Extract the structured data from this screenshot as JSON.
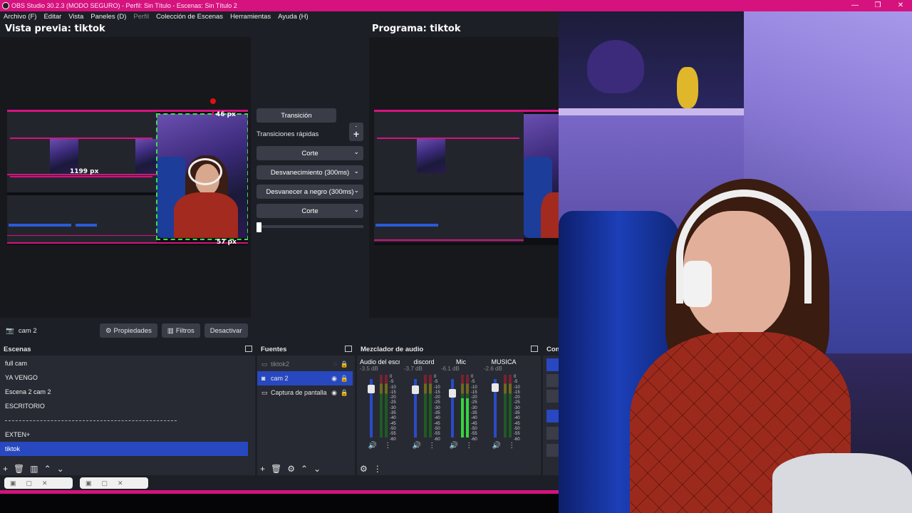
{
  "window": {
    "title": "OBS Studio 30.2.3 (MODO SEGURO) - Perfil: Sin Título - Escenas: Sin Título 2",
    "minimize": "—",
    "restore": "❐",
    "close": "✕"
  },
  "menu": {
    "file": "Archivo (F)",
    "edit": "Editar",
    "view": "Vista",
    "docks": "Paneles (D)",
    "profile": "Perfil",
    "scene_collection": "Colección de Escenas",
    "tools": "Herramientas",
    "help": "Ayuda (H)"
  },
  "preview": {
    "title": "Vista previa: tiktok",
    "label_top": "46 px",
    "label_left": "1199 px",
    "label_bottom": "57 px"
  },
  "program": {
    "title": "Programa: tiktok"
  },
  "transitions": {
    "transition_button": "Transición",
    "quick_label": "Transiciones rápidas",
    "items": [
      "Corte",
      "Desvanecimiento (300ms)",
      "Desvanecer a negro (300ms)",
      "Corte"
    ],
    "slider_value": 0
  },
  "context_bar": {
    "source_name": "cam 2",
    "properties": "Propiedades",
    "filters": "Filtros",
    "deactivate": "Desactivar"
  },
  "scenes": {
    "title": "Escenas",
    "items": [
      "full cam",
      "YA VENGO",
      "Escena 2 cam 2",
      "ESCRITORIO",
      "",
      "EXTEN+",
      "tiktok"
    ],
    "selected": "tiktok"
  },
  "sources": {
    "title": "Fuentes",
    "items": [
      {
        "name": "tiktok2",
        "icon": "scene-icon",
        "visible": false
      },
      {
        "name": "cam 2",
        "icon": "camera-icon",
        "visible": true
      },
      {
        "name": "Captura de pantalla",
        "icon": "monitor-icon",
        "visible": true
      }
    ],
    "selected": "cam 2"
  },
  "mixer": {
    "title": "Mezclador de audio",
    "channels": [
      {
        "name": "Audio del escrito",
        "db": "-3.5 dB",
        "level": 0.0,
        "fader": 0.88
      },
      {
        "name": "discord",
        "db": "-3.7 dB",
        "level": 0.0,
        "fader": 0.87
      },
      {
        "name": "Mic",
        "db": "-6.1 dB",
        "level": 0.62,
        "fader": 0.8
      },
      {
        "name": "MUSICA",
        "db": "-2.6 dB",
        "level": 0.0,
        "fader": 0.92
      }
    ],
    "scale": [
      "0",
      "-5",
      "-10",
      "-15",
      "-20",
      "-25",
      "-30",
      "-35",
      "-40",
      "-45",
      "-50",
      "-55",
      "-60"
    ]
  },
  "controls": {
    "title": "Con"
  },
  "colors": {
    "accent": "#d6127e",
    "selection": "#2848c0",
    "panel": "#272a33",
    "background": "#1d1f26"
  }
}
